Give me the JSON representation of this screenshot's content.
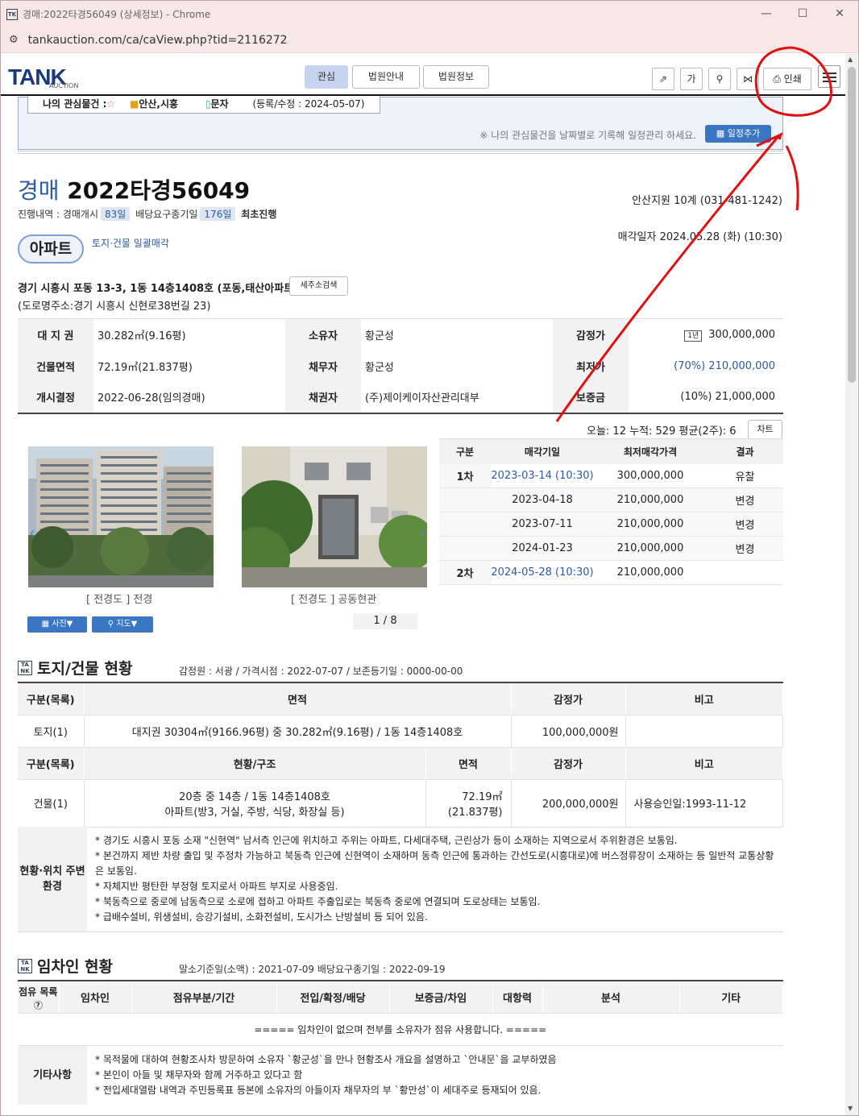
{
  "window": {
    "title": "경매:2022타경56049 (상세정보) - Chrome",
    "url": "tankauction.com/ca/caView.php?tid=2116272"
  },
  "header": {
    "logo": "TANK",
    "logo_sub": "AUCTION",
    "nav": [
      {
        "label": "관심"
      },
      {
        "label": "법원안내"
      },
      {
        "label": "법원정보"
      }
    ],
    "tools": {
      "font_size": "가",
      "print_label": "인쇄"
    }
  },
  "favorite": {
    "label": "나의 관심물건 :",
    "region": "안산,시흥",
    "sms": "문자",
    "updated": "(등록/수정 : 2024-05-07)",
    "note": "※ 나의 관심물건을 날짜별로 기록해 일정관리 하세요.",
    "schedule_button": "일정추가"
  },
  "case": {
    "type": "경매",
    "number": "2022타경56049",
    "court": "안산지원 10계 (031-481-1242)",
    "progress_label": "진행내역 : 경매개시",
    "days_start": "83일",
    "demand_label": "배당요구종기일",
    "days_demand": "176일",
    "status": "최초진행",
    "sale_date": "매각일자 2024.05.28 (화) (10:30)",
    "category": "아파트",
    "sale_scope": "토지·건물 일괄매각",
    "address": "경기 시흥시 포동 13-3, 1동 14층1408호 (포동,태산아파트)",
    "road_address": "(도로명주소:경기 시흥시 신현로38번길 23)",
    "tenant_search": "세주소검색"
  },
  "summary": {
    "rows": [
      [
        "대 지 권",
        "30.282㎡(9.16평)",
        "소유자",
        "황군성",
        "감정가",
        "300,000,000"
      ],
      [
        "건물면적",
        "72.19㎡(21.837평)",
        "채무자",
        "황군성",
        "최저가",
        "(70%) 210,000,000"
      ],
      [
        "개시결정",
        "2022-06-28(임의경매)",
        "채권자",
        "(주)제이케이자산관리대부",
        "보증금",
        "(10%) 21,000,000"
      ]
    ],
    "stats": "오늘: 12  누적: 529  평균(2주): 6",
    "chart_button": "차트"
  },
  "photos": {
    "captions": [
      "[ 전경도 ] 전경",
      "[ 전경도 ] 공동현관"
    ],
    "photo_button": "사진▼",
    "map_button": "지도▼",
    "pager": "1 / 8"
  },
  "history": {
    "headers": [
      "구분",
      "매각기일",
      "최저매각가격",
      "결과"
    ],
    "rows": [
      [
        "1차",
        "2023-03-14 (10:30)",
        "300,000,000",
        "유찰"
      ],
      [
        "",
        "2023-04-18",
        "210,000,000",
        "변경"
      ],
      [
        "",
        "2023-07-11",
        "210,000,000",
        "변경"
      ],
      [
        "",
        "2024-01-23",
        "210,000,000",
        "변경"
      ],
      [
        "2차",
        "2024-05-28 (10:30)",
        "210,000,000",
        ""
      ]
    ]
  },
  "land": {
    "title": "토지/건물 현황",
    "sub": "감정원 : 서광 / 가격시점 : 2022-07-07 / 보존등기일 : 0000-00-00",
    "h1": [
      "구분(목록)",
      "면적",
      "감정가",
      "비고"
    ],
    "land_row": [
      "토지(1)",
      "대지권 30304㎡(9166.96평) 중 30.282㎡(9.16평) / 1동 14층1408호",
      "100,000,000원",
      ""
    ],
    "h2": [
      "구분(목록)",
      "현황/구조",
      "면적",
      "감정가",
      "비고"
    ],
    "bldg_row": {
      "c1": "건물(1)",
      "c2a": "20층 중 14층 / 1동 14층1408호",
      "c2b": "아파트(방3, 거실, 주방, 식당, 화장실 등)",
      "c3a": "72.19㎡",
      "c3b": "(21.837평)",
      "c4": "200,000,000원",
      "c5": "사용승인일:1993-11-12"
    },
    "env_label": "현황·위치 주변환경",
    "env": [
      "* 경기도 시흥시 포동 소재 \"신현역\" 남서측 인근에 위치하고 주위는 아파트, 다세대주택, 근린상가 등이 소재하는 지역으로서 주위환경은 보통임.",
      "* 본건까지 제반 차량 출입 및 주정차 가능하고 북동측 인근에 신현역이 소재하며 동측 인근에 통과하는 간선도로(시흥대로)에 버스정류장이 소재하는 등 일반적 교통상황은 보통임.",
      "* 자체지반 평탄한 부정형 토지로서 아파트 부지로 사용중임.",
      "* 북동측으로 중로에 남동측으로 소로에 접하고 아파트 주출입로는 북동측 중로에 연결되며 도로상태는 보통임.",
      "* 급배수설비, 위생설비, 승강기설비, 소화전설비, 도시가스 난방설비 등 되어 있음."
    ]
  },
  "tenant": {
    "title": "임차인 현황",
    "sub": "말소기준일(소액) : 2021-07-09    배당요구종기일 : 2022-09-19",
    "headers": [
      "점유 목록",
      "임차인",
      "점유부분/기간",
      "전입/확정/배당",
      "보증금/차임",
      "대항력",
      "분석",
      "기타"
    ],
    "none": "===== 임차인이 없으며 전부를 소유자가 점유 사용합니다. =====",
    "etc_label": "기타사항",
    "etc": [
      "* 목적물에 대하여 현황조사차 방문하여 소유자 `황군성`을 만나 현황조사 개요을 설명하고 `안내문`을 교부하였음",
      "* 본인이 아들 및 채무자와 함께 거주하고 있다고 함",
      "* 전입세대열람 내역과 주민등록표 등본에 소유자의 아들이자 채무자의 부 `황만성`이 세대주로 등재되어 있음."
    ]
  }
}
